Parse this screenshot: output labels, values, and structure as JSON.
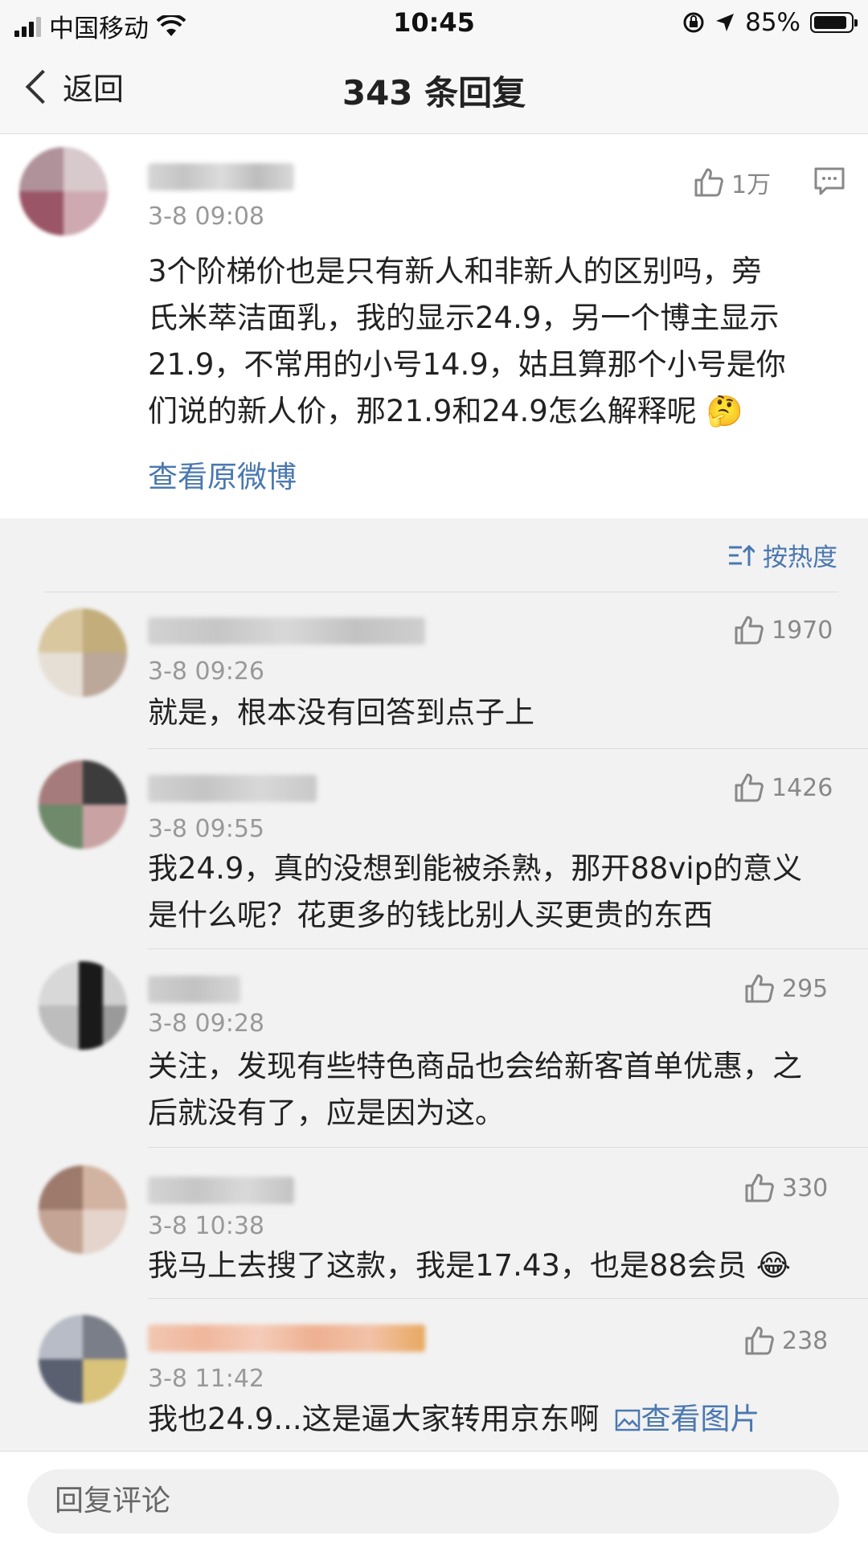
{
  "status_bar": {
    "carrier": "中国移动",
    "time": "10:45",
    "battery": "85%"
  },
  "nav": {
    "back_label": "返回",
    "title": "343 条回复"
  },
  "main_comment": {
    "time": "3-8 09:08",
    "likes": "1万",
    "lines": [
      "3个阶梯价也是只有新人和非新人的区别吗，旁",
      "氏米萃洁面乳，我的显示24.9，另一个博主显示",
      "21.9，不常用的小号14.9，姑且算那个小号是你",
      "们说的新人价，那21.9和24.9怎么解释呢 🤔"
    ],
    "view_original": "查看原微博"
  },
  "sort_label": "按热度",
  "replies": [
    {
      "time": "3-8 09:26",
      "likes": "1970",
      "lines": [
        "就是，根本没有回答到点子上"
      ]
    },
    {
      "time": "3-8 09:55",
      "likes": "1426",
      "lines": [
        "我24.9，真的没想到能被杀熟，那开88vip的意义",
        "是什么呢？花更多的钱比别人买更贵的东西"
      ]
    },
    {
      "time": "3-8 09:28",
      "likes": "295",
      "lines": [
        "关注，发现有些特色商品也会给新客首单优惠，之",
        "后就没有了，应是因为这。"
      ]
    },
    {
      "time": "3-8 10:38",
      "likes": "330",
      "lines": [
        "我马上去搜了这款，我是17.43，也是88会员 😂"
      ]
    },
    {
      "time": "3-8 11:42",
      "likes": "238",
      "lines": [
        "我也24.9...这是逼大家转用京东啊"
      ],
      "image_link": "查看图片"
    }
  ],
  "reply_placeholder": "回复评论",
  "colors": {
    "link": "#4a78b0",
    "muted": "#999999",
    "background": "#f2f2f2"
  }
}
